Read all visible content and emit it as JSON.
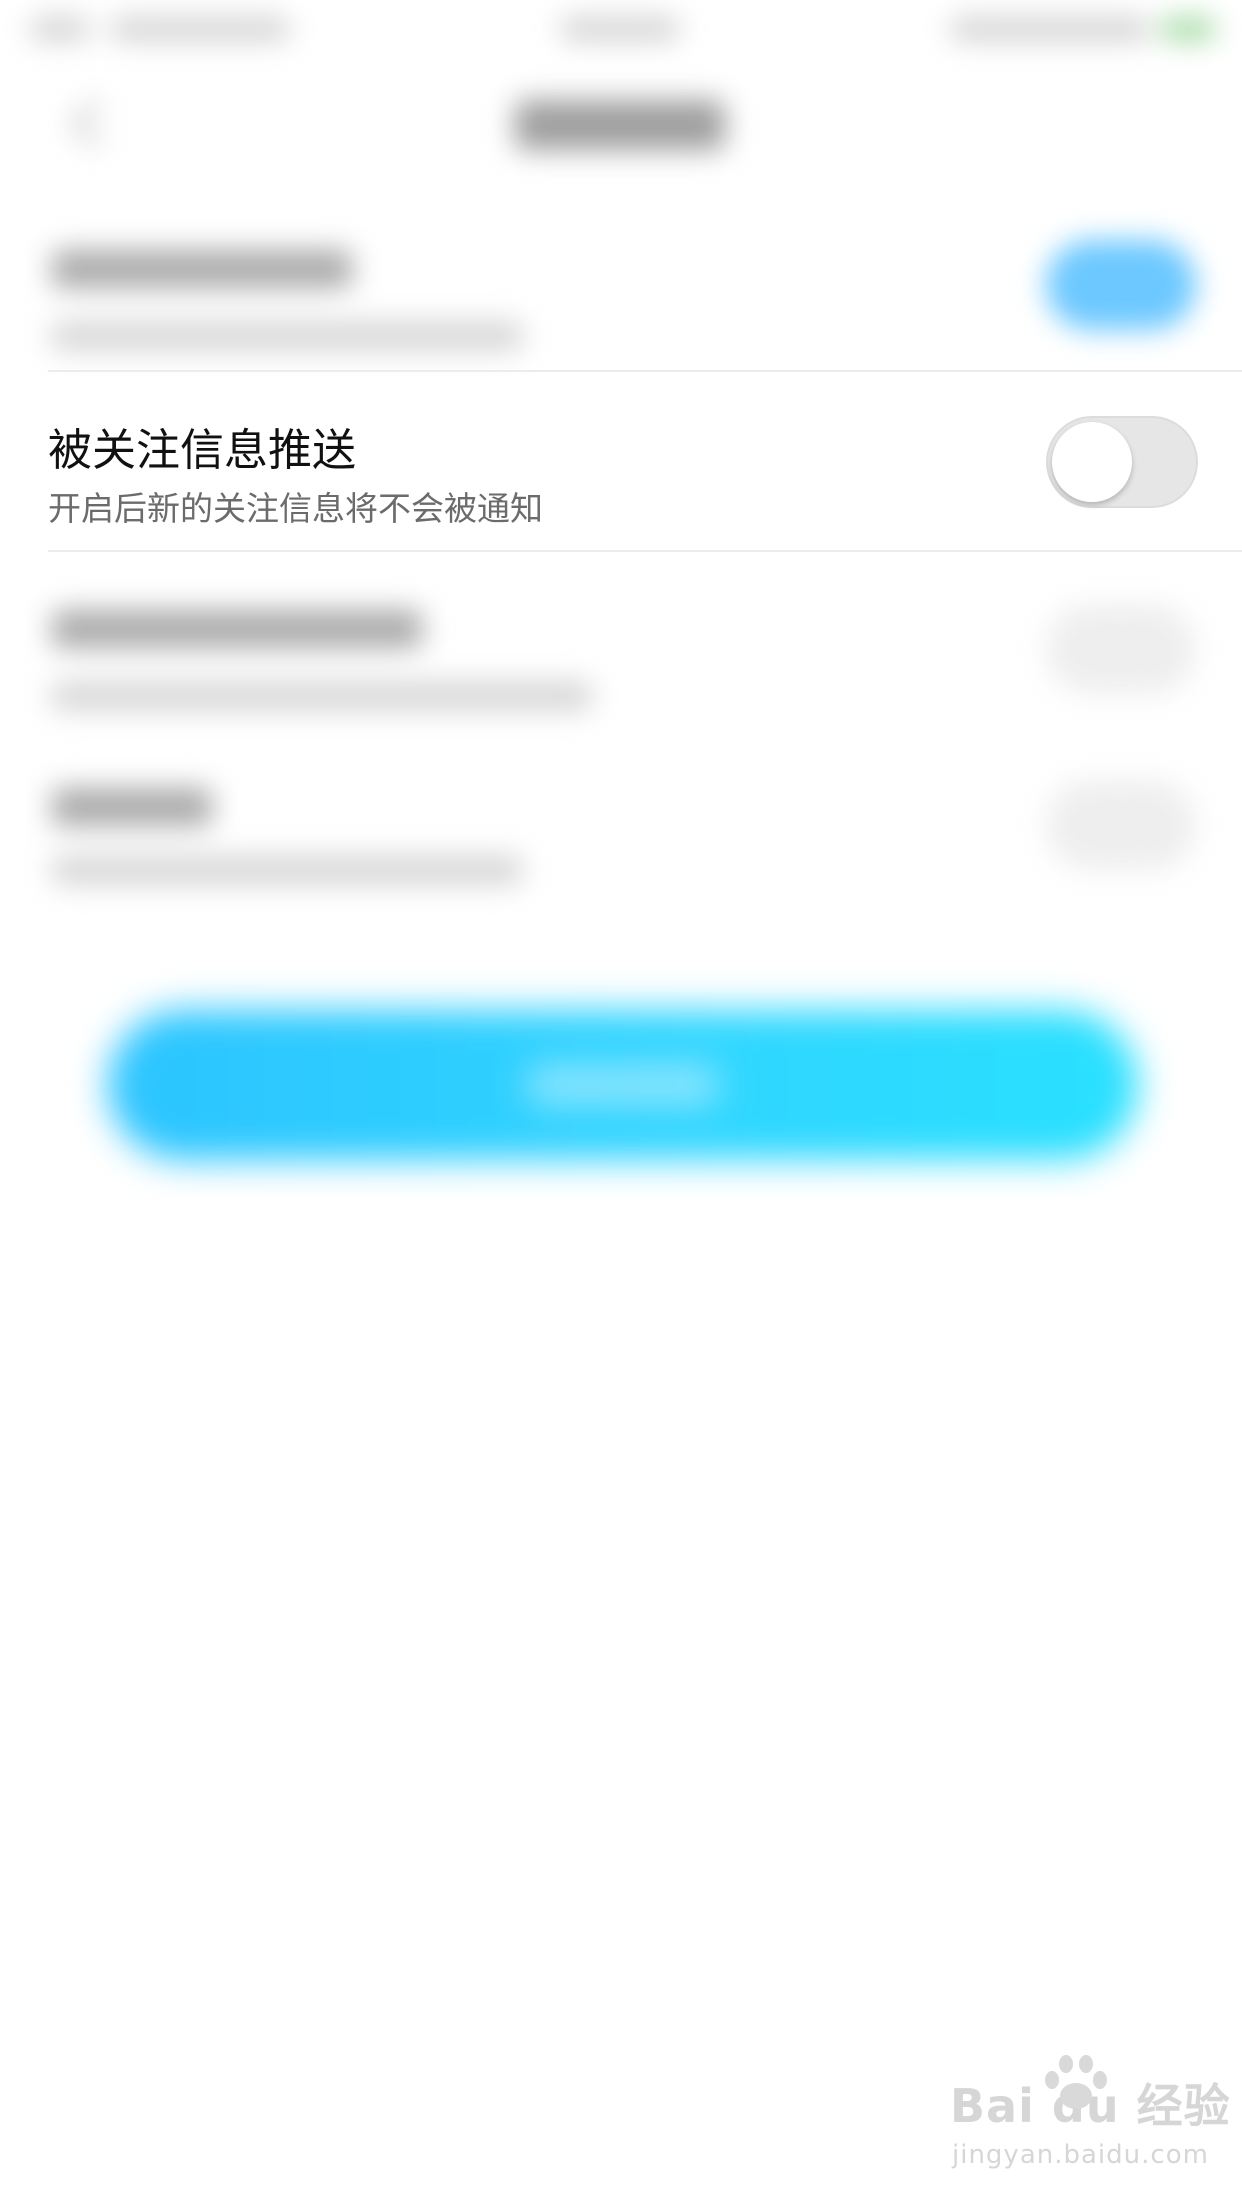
{
  "settings": {
    "follow_push": {
      "title": "被关注信息推送",
      "subtitle": "开启后新的关注信息将不会被通知",
      "enabled": false
    }
  },
  "colors": {
    "accent": "#2fd0ff",
    "toggle_on_blurred": "#6cc8ff",
    "toggle_off_track": "#e6e6e6",
    "title_text": "#111111",
    "subtitle_text": "#6b6b6b"
  },
  "icons": {
    "back": "chevron-left-icon",
    "status_battery": "battery-icon"
  },
  "watermark": {
    "logo": "Bai du 经验",
    "url": "jingyan.baidu.com"
  }
}
